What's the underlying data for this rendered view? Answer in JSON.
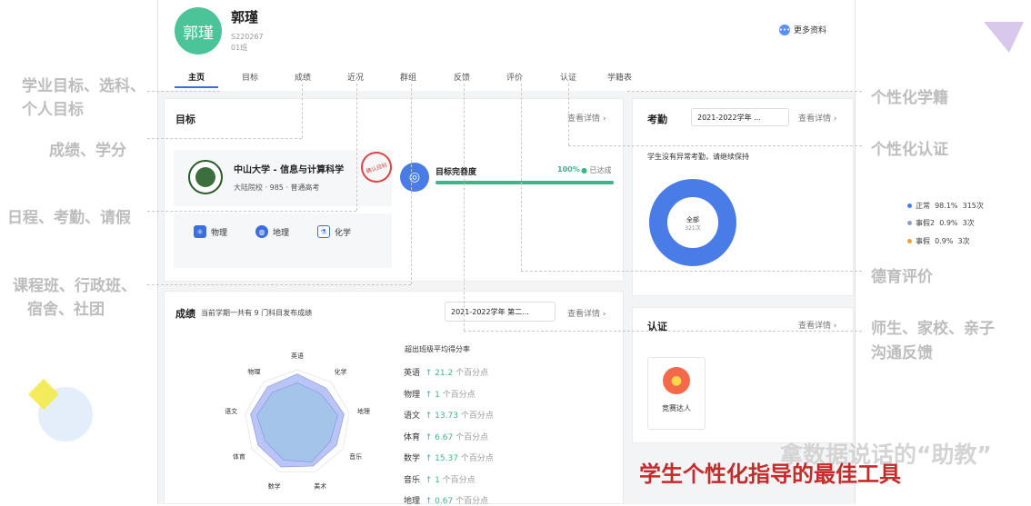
{
  "profile": {
    "avatar_text": "郭瑾",
    "name": "郭瑾",
    "student_id": "S220267",
    "class_name": "01班",
    "more_label": "更多资料"
  },
  "tabs": [
    "主页",
    "目标",
    "成绩",
    "近况",
    "群组",
    "反馈",
    "评价",
    "认证",
    "学籍表"
  ],
  "goal": {
    "title": "目标",
    "detail_link": "查看详情 ›",
    "university": "中山大学 - 信息与计算科学",
    "tags": "大陆院校 · 985 · 普通高考",
    "stamp": "确认目标",
    "progress_label": "目标完善度",
    "progress_value": 100,
    "progress_text": "100%",
    "status": "已达成",
    "subjects": [
      "物理",
      "地理",
      "化学"
    ]
  },
  "attendance": {
    "title": "考勤",
    "year_select": "2021-2022学年 ...",
    "detail_link": "查看详情 ›",
    "message": "学生没有异常考勤，请继续保持",
    "center_label": "全部",
    "center_count": "321次",
    "legend": [
      {
        "name": "正常",
        "pct": "98.1%",
        "count": "315次",
        "color": "#4a7ce8",
        "value": 98.1
      },
      {
        "name": "事假2",
        "pct": "0.9%",
        "count": "3次",
        "color": "#8aa0c8",
        "value": 0.9
      },
      {
        "name": "事假",
        "pct": "0.9%",
        "count": "3次",
        "color": "#e8a33a",
        "value": 0.9
      }
    ]
  },
  "grades": {
    "title": "成绩",
    "subtitle": "当前学期一共有 9 门科目发布成绩",
    "year_select": "2021-2022学年 第二...",
    "detail_link": "查看详情 ›",
    "compare_title": "超出班级平均得分率",
    "unit": "个百分点",
    "items": [
      {
        "subject": "英语",
        "value": "21.2"
      },
      {
        "subject": "物理",
        "value": "1"
      },
      {
        "subject": "语文",
        "value": "13.73"
      },
      {
        "subject": "体育",
        "value": "6.67"
      },
      {
        "subject": "数学",
        "value": "15.37"
      },
      {
        "subject": "音乐",
        "value": "1"
      },
      {
        "subject": "地理",
        "value": "0.67"
      }
    ]
  },
  "chart_data": {
    "type": "radar",
    "categories": [
      "英语",
      "化学",
      "地理",
      "音乐",
      "美术",
      "数学",
      "体育",
      "语文",
      "物理"
    ],
    "series": [
      {
        "values": [
          0.92,
          0.85,
          0.9,
          0.86,
          0.88,
          0.9,
          0.86,
          0.9,
          0.88
        ],
        "color": "#a9b7f2"
      },
      {
        "values": [
          0.75,
          0.7,
          0.78,
          0.72,
          0.8,
          0.76,
          0.7,
          0.78,
          0.74
        ],
        "color": "#9dc3e6"
      }
    ],
    "ylim": [
      0,
      1
    ]
  },
  "certification": {
    "title": "认证",
    "detail_link": "查看详情 ›",
    "badge_label": "竞赛达人"
  },
  "annotations": {
    "goal": "学业目标、选科、",
    "goal2": "个人目标",
    "grades": "成绩、学分",
    "schedule": "日程、考勤、请假",
    "classes": "课程班、行政班、",
    "classes2": "宿舍、社团",
    "records": "个性化学籍",
    "cert": "个性化认证",
    "moral": "德育评价",
    "comm": "师生、家校、亲子",
    "comm2": "沟通反馈",
    "slogan1": "拿数据说话的“助教”",
    "slogan2": "学生个性化指导的最佳工具"
  }
}
